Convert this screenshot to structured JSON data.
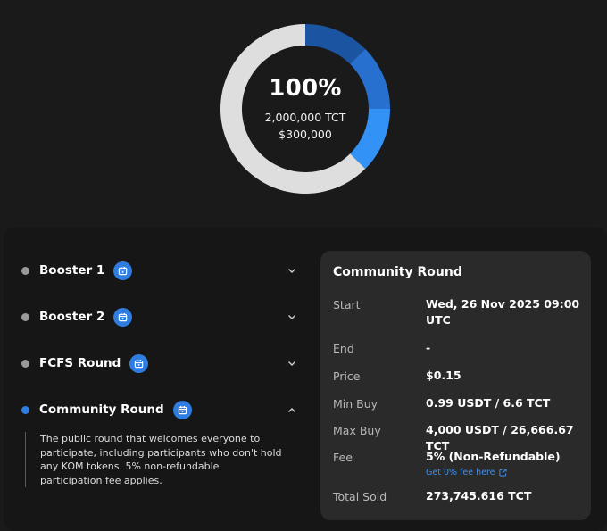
{
  "summary": {
    "percent": "100%",
    "tokens": "2,000,000 TCT",
    "usd": "$300,000",
    "segments": [
      {
        "round": "Booster 1",
        "share": 0.125,
        "color": "#1b54a0"
      },
      {
        "round": "Booster 2",
        "share": 0.125,
        "color": "#2870cf"
      },
      {
        "round": "FCFS Round",
        "share": 0.125,
        "color": "#3392f5"
      },
      {
        "round": "Community Round",
        "share": 0.625,
        "color": "#dedede"
      }
    ]
  },
  "rounds": [
    {
      "name": "Booster 1",
      "active": false,
      "expanded": false
    },
    {
      "name": "Booster 2",
      "active": false,
      "expanded": false
    },
    {
      "name": "FCFS Round",
      "active": false,
      "expanded": false
    },
    {
      "name": "Community Round",
      "active": true,
      "expanded": true,
      "description": "The public round that welcomes everyone to participate, including participants who don't hold any KOM tokens. 5% non-refundable participation fee applies."
    }
  ],
  "details": {
    "title": "Community Round",
    "start_label": "Start",
    "start_value": "Wed, 26 Nov 2025 09:00 UTC",
    "end_label": "End",
    "end_value": "-",
    "price_label": "Price",
    "price_value": "$0.15",
    "min_buy_label": "Min Buy",
    "min_buy_value": "0.99 USDT / 6.6 TCT",
    "max_buy_label": "Max Buy",
    "max_buy_value": "4,000 USDT / 26,666.67 TCT",
    "fee_label": "Fee",
    "fee_value": "5% (Non-Refundable)",
    "fee_link": "Get 0% fee here",
    "sold_label": "Total Sold",
    "sold_value": "273,745.616 TCT"
  },
  "icons": {
    "round_icon": "calendar-icon",
    "collapsed_icon": "chevron-down-icon",
    "expanded_icon": "chevron-up-icon",
    "link_icon": "external-link-icon"
  },
  "colors": {
    "accent": "#2f7de1",
    "link": "#3d8ff0",
    "inactive_dot": "#9a9a9a"
  }
}
